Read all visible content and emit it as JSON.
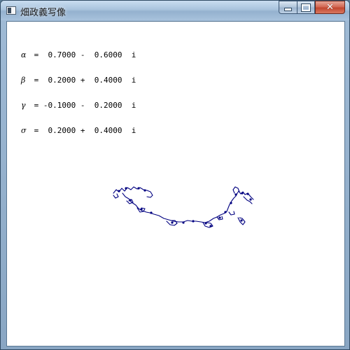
{
  "window": {
    "title": "畑政義写像",
    "minimize_label": "",
    "maximize_label": "",
    "close_label": "✕"
  },
  "params": [
    {
      "symbol": "α",
      "text": " =  0.7000 -  0.6000  i"
    },
    {
      "symbol": "β",
      "text": " =  0.2000 +  0.4000  i"
    },
    {
      "symbol": "γ",
      "text": " = -0.1000 -  0.2000  i"
    },
    {
      "symbol": "σ",
      "text": " =  0.2000 +  0.4000  i"
    }
  ],
  "curve": {
    "color": "#000080"
  }
}
